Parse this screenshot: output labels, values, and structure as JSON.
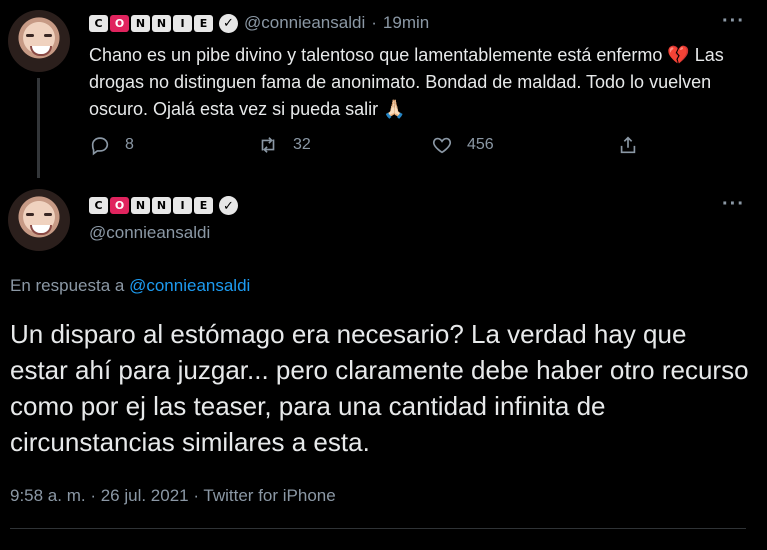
{
  "colors": {
    "background": "#000000",
    "text": "#e7e9ea",
    "muted": "#8b98a5",
    "link": "#1d9bf0",
    "name_accent": "#e0245e"
  },
  "tweet1": {
    "avatar_icon": "user-avatar-icon",
    "name_letters": [
      "C",
      "O",
      "N",
      "N",
      "I",
      "E"
    ],
    "verified_icon": "check-icon",
    "handle": "@connieansaldi",
    "separator": "·",
    "time": "19min",
    "more_icon": "more-icon",
    "more_label": "···",
    "body": "Chano es un pibe divino y talentoso que lamentablemente está enfermo 💔 Las drogas no distinguen fama de anonimato. Bondad de maldad. Todo lo vuelven oscuro. Ojalá esta vez si pueda salir 🙏🏻",
    "replies": "8",
    "retweets": "32",
    "likes": "456"
  },
  "tweet2": {
    "avatar_icon": "user-avatar-icon",
    "name_letters": [
      "C",
      "O",
      "N",
      "N",
      "I",
      "E"
    ],
    "verified_icon": "check-icon",
    "handle": "@connieansaldi",
    "more_label": "···",
    "reply_prefix": "En respuesta a",
    "reply_mention": "@connieansaldi",
    "body": "Un disparo al estómago era necesario? La verdad hay que estar ahí para juzgar... pero claramente debe haber otro recurso como por ej las teaser, para una cantidad infinita de circunstancias similares a esta.",
    "meta": "9:58 a. m. · 26 jul. 2021 · Twitter for iPhone"
  }
}
